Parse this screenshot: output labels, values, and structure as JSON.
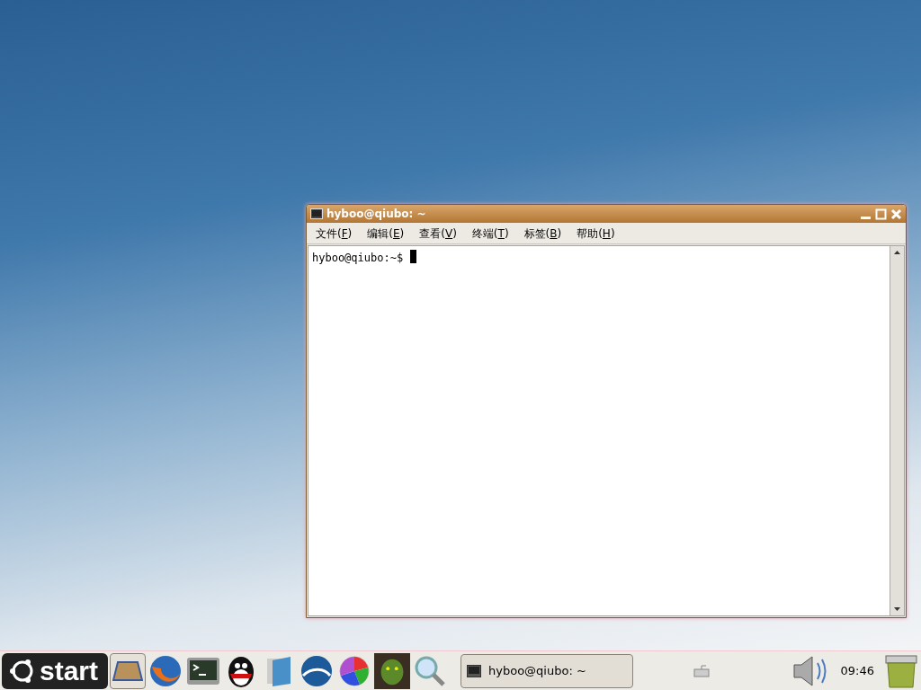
{
  "window": {
    "title": "hyboo@qiubo: ~"
  },
  "menu": [
    {
      "prefix": "文件(",
      "key": "F",
      "suffix": ")"
    },
    {
      "prefix": "编辑(",
      "key": "E",
      "suffix": ")"
    },
    {
      "prefix": "查看(",
      "key": "V",
      "suffix": ")"
    },
    {
      "prefix": "终端(",
      "key": "T",
      "suffix": ")"
    },
    {
      "prefix": "标签(",
      "key": "B",
      "suffix": ")"
    },
    {
      "prefix": "帮助(",
      "key": "H",
      "suffix": ")"
    }
  ],
  "terminal": {
    "prompt": "hyboo@qiubo:~$"
  },
  "taskbar": {
    "start": "start",
    "task": "hyboo@qiubo: ~",
    "clock": "09:46"
  }
}
